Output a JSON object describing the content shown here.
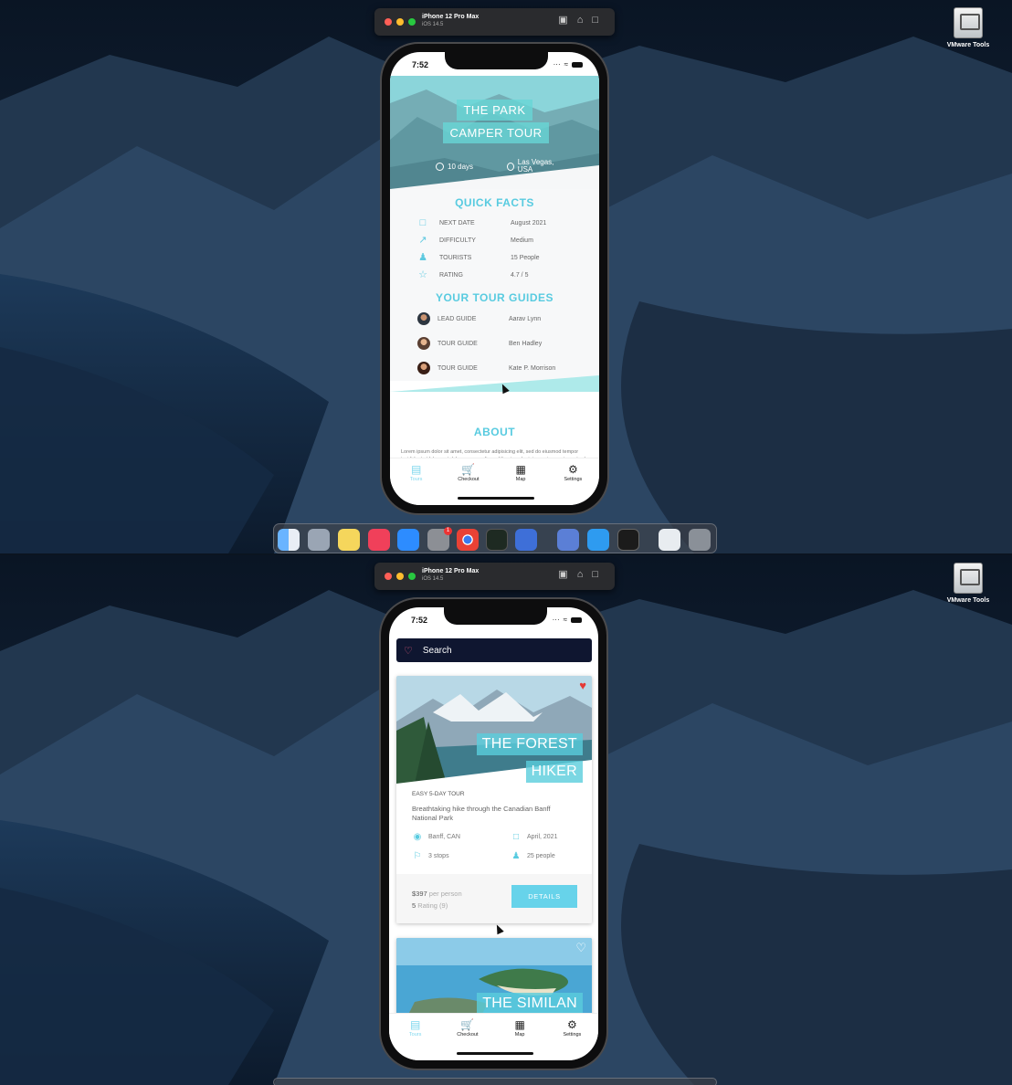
{
  "simulator": {
    "device_name": "iPhone 12 Pro Max",
    "os_version": "iOS 14.5"
  },
  "desktop": {
    "vmware_label": "VMware Tools"
  },
  "status_bar": {
    "time": "7:52"
  },
  "tour_detail": {
    "title_line1": "THE PARK",
    "title_line2": "CAMPER TOUR",
    "duration": "10 days",
    "location": "Las Vegas, USA",
    "quick_facts_heading": "QUICK FACTS",
    "facts": [
      {
        "icon": "calendar-icon",
        "label": "NEXT DATE",
        "value": "August 2021"
      },
      {
        "icon": "trending-icon",
        "label": "DIFFICULTY",
        "value": "Medium"
      },
      {
        "icon": "user-icon",
        "label": "TOURISTS",
        "value": "15 People"
      },
      {
        "icon": "star-icon",
        "label": "RATING",
        "value": "4.7 / 5"
      }
    ],
    "guides_heading": "YOUR TOUR GUIDES",
    "guides": [
      {
        "role": "LEAD GUIDE",
        "name": "Aarav Lynn"
      },
      {
        "role": "TOUR GUIDE",
        "name": "Ben Hadley"
      },
      {
        "role": "TOUR GUIDE",
        "name": "Kate P. Morrison"
      }
    ],
    "about_heading": "ABOUT",
    "about_text": "Lorem ipsum dolor sit amet, consectetur adipisicing elit, sed do eiusmod tempor incididunt ut labore et dolore magna aliqua. Ut enim ad minim veniam, quis nostrud exercitation ullamco laboris nisi ut aliquip ex ea"
  },
  "tab_bar": {
    "tabs": [
      {
        "icon": "briefcase-icon",
        "label": "Tours",
        "active": true
      },
      {
        "icon": "cart-icon",
        "label": "Checkout",
        "active": false
      },
      {
        "icon": "map-icon",
        "label": "Map",
        "active": false
      },
      {
        "icon": "gear-icon",
        "label": "Settings",
        "active": false
      }
    ]
  },
  "tour_list": {
    "search_placeholder": "Search",
    "cards": [
      {
        "title_line1": "THE FOREST",
        "title_line2": "HIKER",
        "favorited": true,
        "subtitle": "EASY 5-DAY TOUR",
        "summary": "Breathtaking hike through the Canadian Banff National Park",
        "location": "Banff, CAN",
        "date": "April, 2021",
        "stops": "3 stops",
        "people": "25 people",
        "price": "$397",
        "price_unit": "per person",
        "rating": "5",
        "rating_label": "Rating (9)",
        "button": "DETAILS"
      },
      {
        "title_line1": "THE SIMILAN",
        "favorited": false
      }
    ]
  },
  "colors": {
    "accent": "#58cbe0",
    "search_bg": "#0f1630",
    "heart": "#e53935"
  }
}
